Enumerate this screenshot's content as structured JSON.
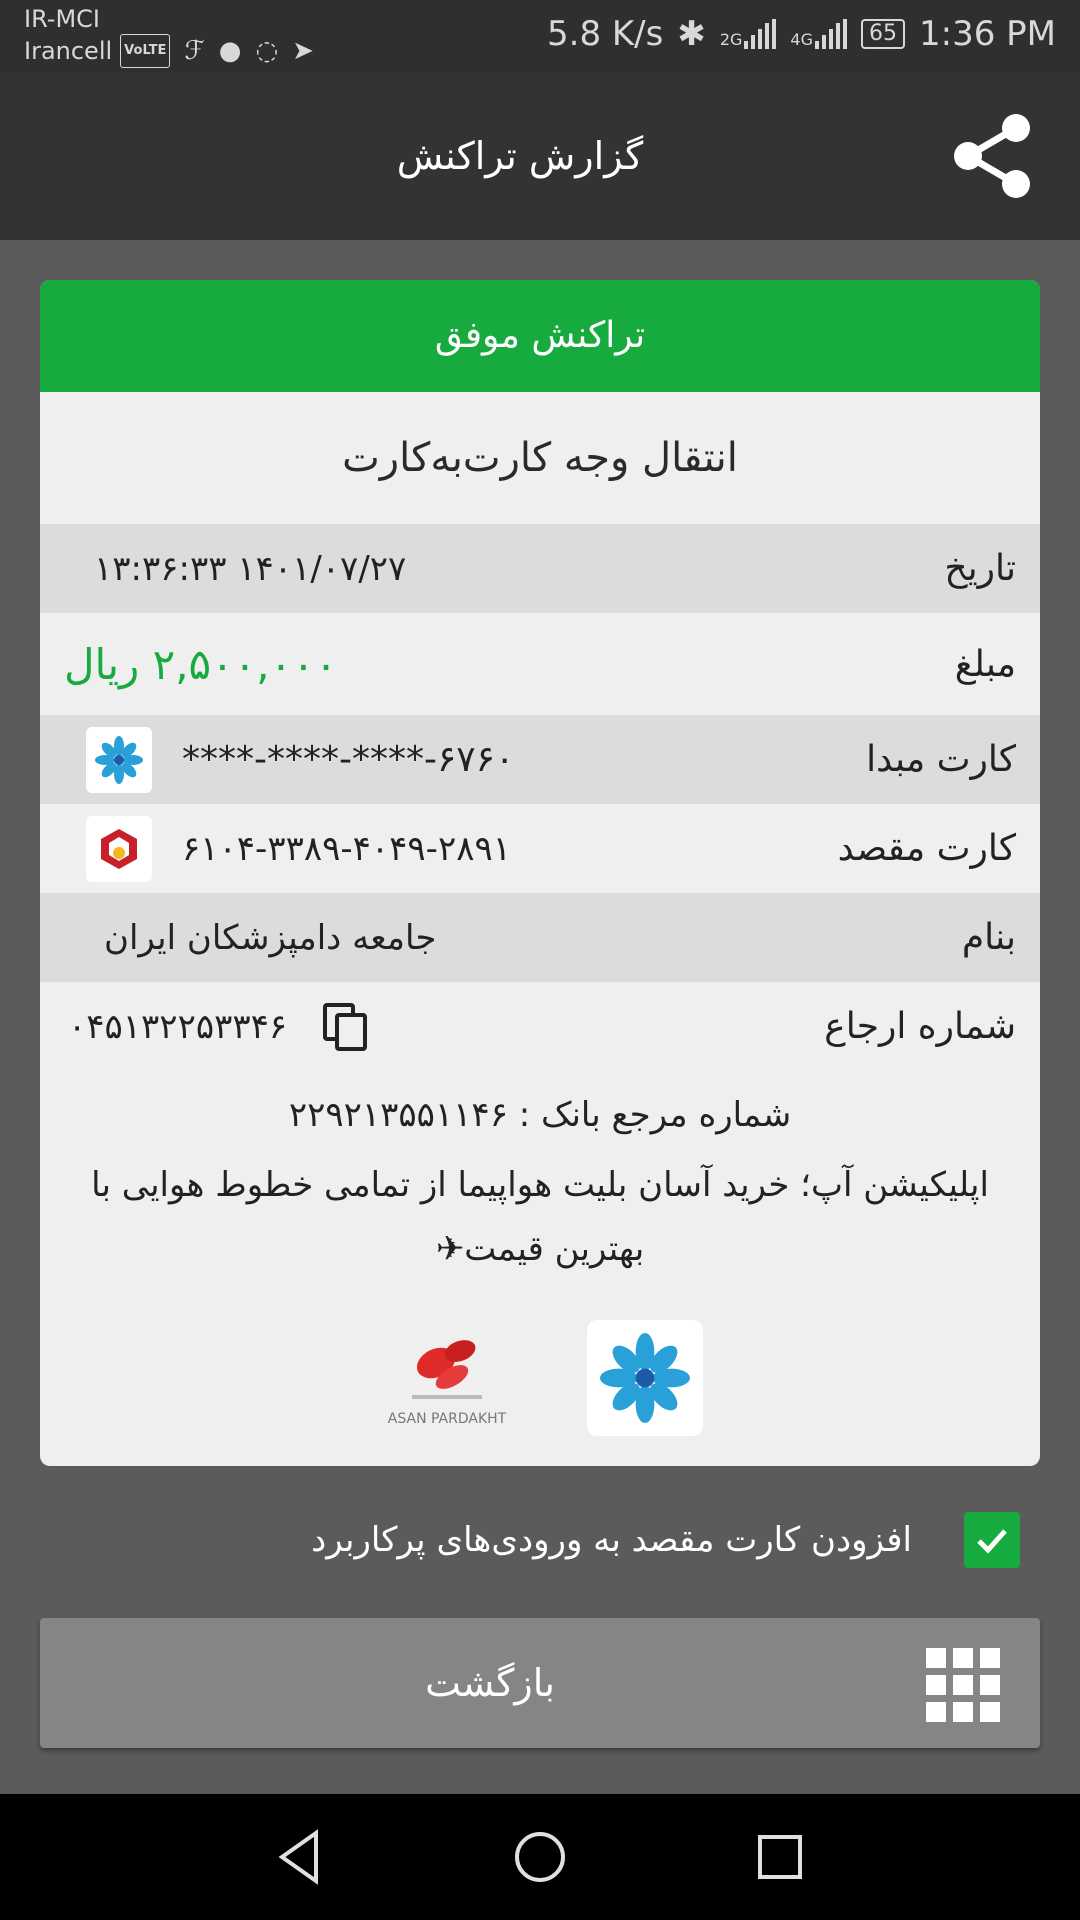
{
  "status_bar": {
    "carrier_top": "IR-MCI",
    "carrier_bottom": "Irancell",
    "volte": "VoLTE",
    "speed": "5.8 K/s",
    "net1": "2G",
    "net2": "4G",
    "battery": "65",
    "time": "1:36 PM"
  },
  "appbar": {
    "title": "گزارش تراکنش"
  },
  "card": {
    "header": "تراکنش موفق",
    "subtitle": "انتقال وجه کارت‌به‌کارت",
    "rows": {
      "date": {
        "label": "تاریخ",
        "value": "۱۴۰۱/۰۷/۲۷ ۱۳:۳۶:۳۳"
      },
      "amount": {
        "label": "مبلغ",
        "value": "۲,۵۰۰,۰۰۰ ریال"
      },
      "source_card": {
        "label": "کارت مبدا",
        "value": "****-****-****-۶۷۶۰"
      },
      "dest_card": {
        "label": "کارت مقصد",
        "value": "۶۱۰۴-۳۳۸۹-۴۰۴۹-۲۸۹۱"
      },
      "name": {
        "label": "بنام",
        "value": "جامعه دامپزشکان ایران"
      },
      "reference": {
        "label": "شماره ارجاع",
        "value": "۰۴۵۱۳۲۲۵۳۳۴۶"
      }
    },
    "bank_ref": "شماره مرجع بانک : ۲۲۹۲۱۳۵۵۱۱۴۶",
    "ad_text": "اپلیکیشن آپ؛ خرید آسان بلیت هواپیما از تمامی خطوط هوایی با بهترین قیمت✈",
    "asan_logo_text": "ASAN PARDAKHT"
  },
  "save_destination": {
    "label": "افزودن کارت مقصد به ورودی‌های پرکاربرد",
    "checked": true
  },
  "back_button": {
    "label": "بازگشت"
  },
  "colors": {
    "success_green": "#17ab3f",
    "appbar": "#333333",
    "background": "#5b5b5b"
  }
}
